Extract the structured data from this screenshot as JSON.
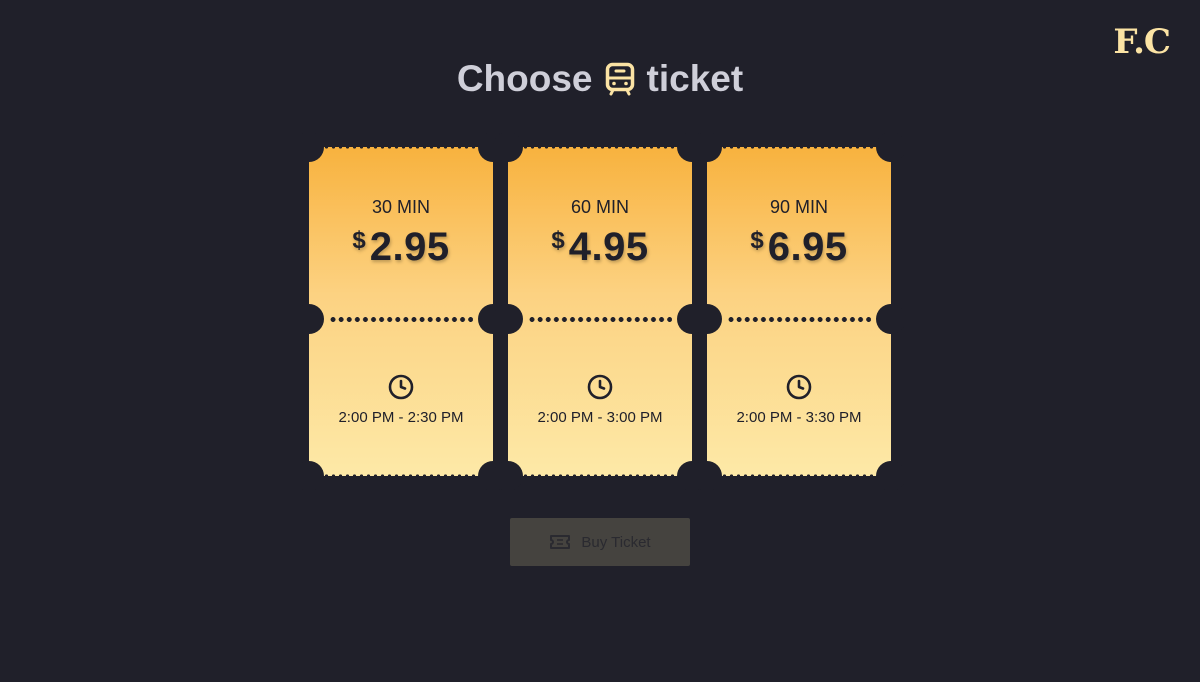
{
  "brand": {
    "logo": "F.C"
  },
  "header": {
    "title_before": "Choose",
    "title_icon": "bus-icon",
    "title_after": "ticket"
  },
  "tickets": [
    {
      "duration": "30 MIN",
      "currency": "$",
      "price": "2.95",
      "time_range": "2:00 PM - 2:30 PM",
      "icon": "clock-icon"
    },
    {
      "duration": "60 MIN",
      "currency": "$",
      "price": "4.95",
      "time_range": "2:00 PM - 3:00 PM",
      "icon": "clock-icon"
    },
    {
      "duration": "90 MIN",
      "currency": "$",
      "price": "6.95",
      "time_range": "2:00 PM - 3:30 PM",
      "icon": "clock-icon"
    }
  ],
  "actions": {
    "buy_label": "Buy Ticket",
    "buy_icon": "ticket-icon",
    "buy_disabled": true
  },
  "colors": {
    "background": "#20202a",
    "ticket_top": "#f8b23e",
    "ticket_bottom": "#fde9a7",
    "logo": "#fbe3a4",
    "title": "#cfcfd9",
    "button_disabled": "#45433f"
  }
}
